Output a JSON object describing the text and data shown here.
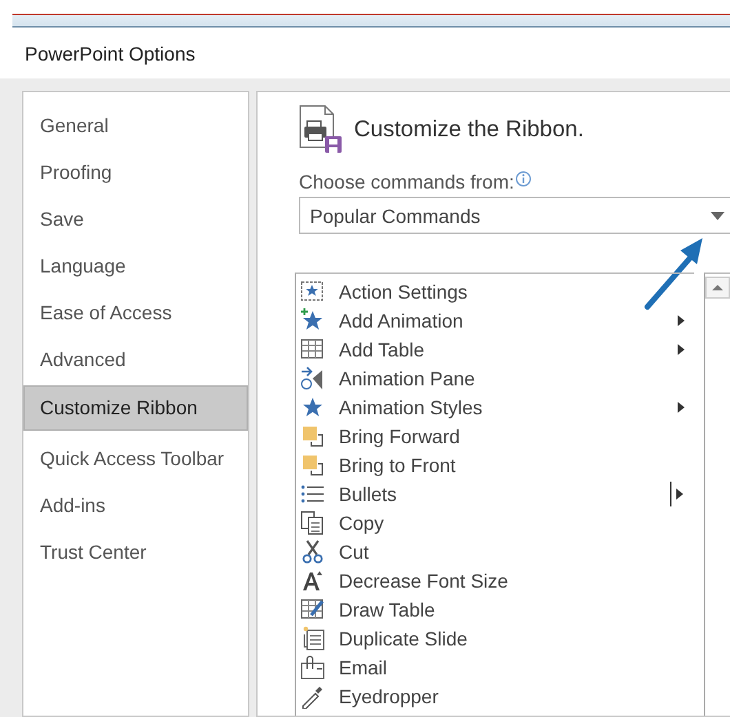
{
  "window": {
    "title": "PowerPoint Options"
  },
  "sidebar": {
    "items": [
      {
        "label": "General",
        "selected": false
      },
      {
        "label": "Proofing",
        "selected": false
      },
      {
        "label": "Save",
        "selected": false
      },
      {
        "label": "Language",
        "selected": false
      },
      {
        "label": "Ease of Access",
        "selected": false
      },
      {
        "label": "Advanced",
        "selected": false
      },
      {
        "label": "Customize Ribbon",
        "selected": true
      },
      {
        "label": "Quick Access Toolbar",
        "selected": false
      },
      {
        "label": "Add-ins",
        "selected": false
      },
      {
        "label": "Trust Center",
        "selected": false
      }
    ]
  },
  "main": {
    "heading": "Customize the Ribbon.",
    "choose_label": "Choose commands from:",
    "dropdown": {
      "value": "Popular Commands"
    },
    "commands": [
      {
        "label": "Action Settings",
        "kind": "plain"
      },
      {
        "label": "Add Animation",
        "kind": "submenu"
      },
      {
        "label": "Add Table",
        "kind": "submenu"
      },
      {
        "label": "Animation Pane",
        "kind": "plain"
      },
      {
        "label": "Animation Styles",
        "kind": "submenu"
      },
      {
        "label": "Bring Forward",
        "kind": "plain"
      },
      {
        "label": "Bring to Front",
        "kind": "plain"
      },
      {
        "label": "Bullets",
        "kind": "split"
      },
      {
        "label": "Copy",
        "kind": "plain"
      },
      {
        "label": "Cut",
        "kind": "plain"
      },
      {
        "label": "Decrease Font Size",
        "kind": "plain"
      },
      {
        "label": "Draw Table",
        "kind": "plain"
      },
      {
        "label": "Duplicate Slide",
        "kind": "plain"
      },
      {
        "label": "Email",
        "kind": "plain"
      },
      {
        "label": "Eyedropper",
        "kind": "plain"
      }
    ]
  }
}
